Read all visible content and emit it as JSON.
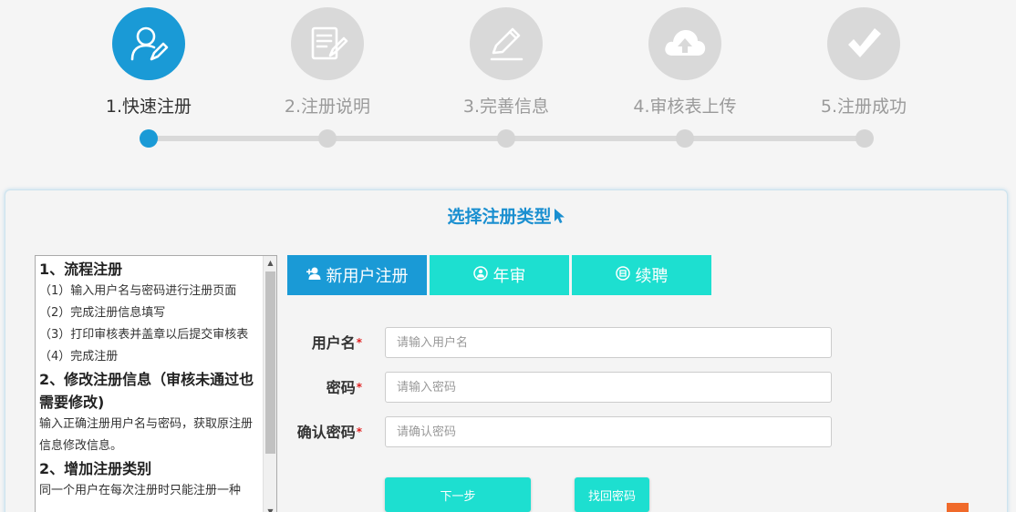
{
  "steps": [
    {
      "label": "1.快速注册",
      "icon": "user-edit-icon",
      "active": true
    },
    {
      "label": "2.注册说明",
      "icon": "document-icon",
      "active": false
    },
    {
      "label": "3.完善信息",
      "icon": "pencil-icon",
      "active": false
    },
    {
      "label": "4.审核表上传",
      "icon": "cloud-upload-icon",
      "active": false
    },
    {
      "label": "5.注册成功",
      "icon": "checkmark-icon",
      "active": false
    }
  ],
  "colors": {
    "primary": "#1a9ad6",
    "teal": "#1ddfd0",
    "inactive": "#d9d9d9",
    "required": "#e02020"
  },
  "panel": {
    "title": "选择注册类型"
  },
  "instructions": {
    "h1": "1、流程注册",
    "s1": "（1）输入用户名与密码进行注册页面",
    "s2": "（2）完成注册信息填写",
    "s3": "（3）打印审核表并盖章以后提交审核表",
    "s4": "（4）完成注册",
    "h2": "2、修改注册信息（审核未通过也需要修改)",
    "p2": "输入正确注册用户名与密码，获取原注册信息修改信息。",
    "h3": "2、增加注册类别",
    "p3": "同一个用户在每次注册时只能注册一种"
  },
  "tabs": [
    {
      "label": "新用户注册",
      "icon": "add-user-icon",
      "active": true
    },
    {
      "label": "年审",
      "icon": "audit-icon",
      "active": false
    },
    {
      "label": "续聘",
      "icon": "renew-icon",
      "active": false
    }
  ],
  "form": {
    "username_label": "用户名",
    "username_placeholder": "请输入用户名",
    "password_label": "密码",
    "password_placeholder": "请输入密码",
    "confirm_label": "确认密码",
    "confirm_placeholder": "请确认密码",
    "required_mark": "*"
  },
  "buttons": {
    "next": "下一步",
    "recover": "找回密码"
  }
}
